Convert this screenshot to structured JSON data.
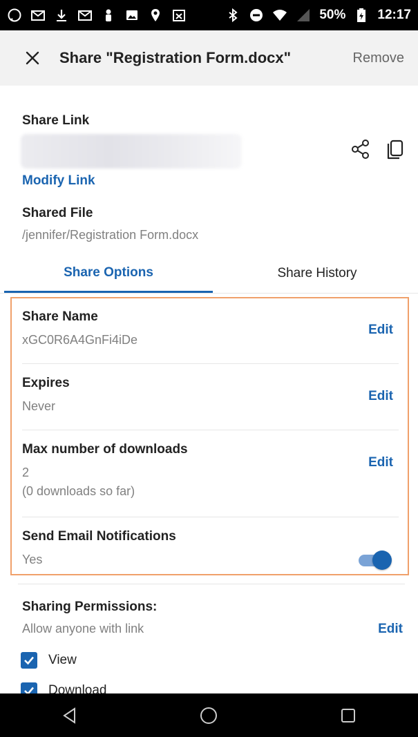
{
  "status_bar": {
    "left_icons": [
      "whatsapp-icon",
      "gmail-icon",
      "download-icon",
      "gmail-icon",
      "person-icon",
      "image-icon",
      "location-icon",
      "calendar-icon"
    ],
    "right_icons": [
      "bluetooth-icon",
      "do-not-disturb-icon",
      "wifi-icon",
      "signal-icon",
      "battery-icon"
    ],
    "battery": "50%",
    "time": "12:17"
  },
  "app_bar": {
    "title": "Share \"Registration Form.docx\"",
    "remove_label": "Remove"
  },
  "share_link": {
    "label": "Share Link",
    "modify_label": "Modify Link"
  },
  "shared_file": {
    "label": "Shared File",
    "path": "/jennifer/Registration Form.docx"
  },
  "tabs": [
    {
      "label": "Share Options",
      "active": true
    },
    {
      "label": "Share History",
      "active": false
    }
  ],
  "options": {
    "share_name": {
      "label": "Share Name",
      "value": "xGC0R6A4GnFi4iDe",
      "action": "Edit"
    },
    "expires": {
      "label": "Expires",
      "value": "Never",
      "action": "Edit"
    },
    "max_downloads": {
      "label": "Max number of downloads",
      "value": "2",
      "note": "(0 downloads so far)",
      "action": "Edit"
    },
    "email_notifications": {
      "label": "Send Email Notifications",
      "value": "Yes",
      "toggle_on": true
    }
  },
  "permissions": {
    "label": "Sharing Permissions:",
    "description": "Allow anyone with link",
    "action": "Edit",
    "checkboxes": [
      {
        "label": "View",
        "checked": true
      },
      {
        "label": "Download",
        "checked": true
      }
    ]
  },
  "colors": {
    "accent": "#1a64b0",
    "highlight_border": "#f0a06a",
    "muted_text": "#808080"
  }
}
